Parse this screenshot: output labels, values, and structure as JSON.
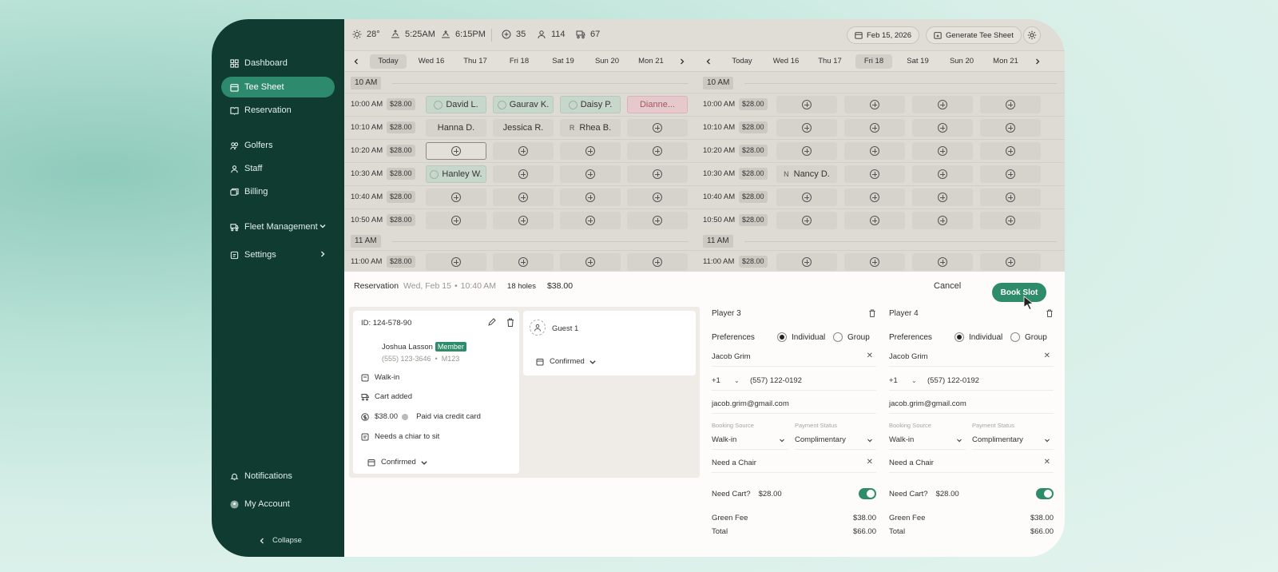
{
  "sidebar": {
    "items": [
      {
        "label": "Dashboard",
        "icon": "grid-icon"
      },
      {
        "label": "Tee Sheet",
        "icon": "calendar-icon",
        "active": true
      },
      {
        "label": "Reservation",
        "icon": "book-icon"
      },
      {
        "label": "Golfers",
        "icon": "users-icon"
      },
      {
        "label": "Staff",
        "icon": "user-icon"
      },
      {
        "label": "Billing",
        "icon": "billing-icon"
      },
      {
        "label": "Fleet Management",
        "icon": "cart-icon"
      },
      {
        "label": "Settings",
        "icon": "settings-icon"
      }
    ],
    "notifications": "Notifications",
    "account": "My Account",
    "collapse": "Collapse"
  },
  "topbar": {
    "temp": "28°",
    "sunrise": "5:25AM",
    "sunset": "6:15PM",
    "stat1": "35",
    "stat2": "114",
    "stat3": "67",
    "date": "Feb 15, 2026",
    "generate": "Generate Tee Sheet"
  },
  "days": [
    "Today",
    "Wed 16",
    "Thu 17",
    "Fri 18",
    "Sat 19",
    "Sun 20",
    "Mon 21"
  ],
  "grid": {
    "hour10": "10 AM",
    "hour11": "11 AM",
    "price": "$28.00",
    "times": [
      "10:00 AM",
      "10:10 AM",
      "10:20 AM",
      "10:30 AM",
      "10:40 AM",
      "10:50 AM",
      "11:00 AM"
    ],
    "left_names": {
      "r0c0": "David L.",
      "r0c1": "Gaurav K.",
      "r0c2": "Daisy P.",
      "r0c3": "Dianne...",
      "r1c0": "Hanna D.",
      "r1c1": "Jessica R.",
      "r1c2": "Rhea B.",
      "r1c2_letter": "R",
      "r3c0": "Hanley W."
    },
    "right_names": {
      "r3c0": "Nancy D.",
      "r3c0_letter": "N"
    }
  },
  "reservation": {
    "title": "Reservation",
    "date": "Wed, Feb 15",
    "time": "10:40 AM",
    "holes": "18 holes",
    "total": "$38.00",
    "cancel": "Cancel",
    "book": "Book Slot"
  },
  "booking_card": {
    "id": "ID: 124-578-90",
    "name": "Joshua Lasson",
    "member": "Member",
    "phone": "(555) 123-3646",
    "member_id": "M123",
    "walkin": "Walk-in",
    "cart": "Cart added",
    "amount": "$38.00",
    "paid": "Paid via credit card",
    "note": "Needs a chiar to sit",
    "status": "Confirmed"
  },
  "guest_card": {
    "label": "Guest 1",
    "status": "Confirmed"
  },
  "player3": {
    "title": "Player 3",
    "pref_label": "Preferences",
    "opt_individual": "Individual",
    "opt_group": "Group",
    "name": "Jacob Grim",
    "code": "+1",
    "phone": "(557) 122-0192",
    "email": "jacob.grim@gmail.com",
    "source_label": "Booking Source",
    "source": "Walk-in",
    "pay_label": "Payment Status",
    "pay": "Complimentary",
    "note": "Need a Chair",
    "cart_q": "Need Cart?",
    "cart_price": "$28.00",
    "green_label": "Green Fee",
    "green": "$38.00",
    "total_label": "Total",
    "total": "$66.00"
  },
  "player4": {
    "title": "Player 4",
    "pref_label": "Preferences",
    "opt_individual": "Individual",
    "opt_group": "Group",
    "name": "Jacob Grim",
    "code": "+1",
    "phone": "(557) 122-0192",
    "email": "jacob.grim@gmail.com",
    "source_label": "Booking Source",
    "source": "Walk-in",
    "pay_label": "Payment Status",
    "pay": "Complimentary",
    "note": "Need a Chair",
    "cart_q": "Need Cart?",
    "cart_price": "$28.00",
    "green_label": "Green Fee",
    "green": "$38.00",
    "total_label": "Total",
    "total": "$66.00"
  },
  "colors": {
    "sidebar": "#0f3b31",
    "accent": "#2f8c6a",
    "pink": "#e6c9cc"
  }
}
